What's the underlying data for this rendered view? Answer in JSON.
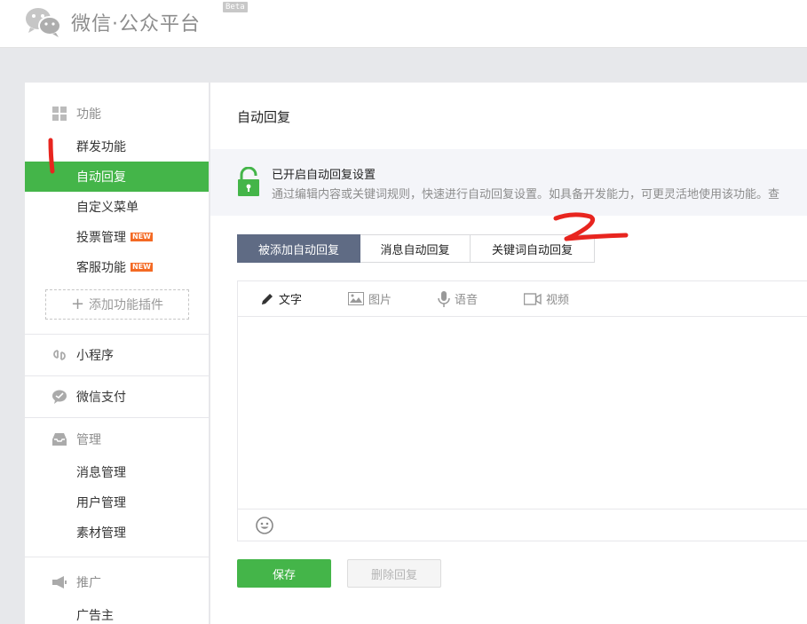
{
  "header": {
    "logo_icon": "wechat-icon",
    "title": "微信·公众平台",
    "beta": "Beta"
  },
  "sidebar": {
    "groups": [
      {
        "label": "功能",
        "icon": "grid-icon",
        "items": [
          {
            "label": "群发功能"
          },
          {
            "label": "自动回复",
            "active": true
          },
          {
            "label": "自定义菜单"
          },
          {
            "label": "投票管理",
            "badge": "NEW"
          },
          {
            "label": "客服功能",
            "badge": "NEW"
          }
        ],
        "add_plugin": "添加功能插件"
      },
      {
        "label": "小程序",
        "icon": "link-icon"
      },
      {
        "label": "微信支付",
        "icon": "pay-icon"
      },
      {
        "label": "管理",
        "icon": "inbox-icon",
        "items": [
          {
            "label": "消息管理"
          },
          {
            "label": "用户管理"
          },
          {
            "label": "素材管理"
          }
        ]
      },
      {
        "label": "推广",
        "icon": "megaphone-icon",
        "items": [
          {
            "label": "广告主"
          }
        ]
      }
    ]
  },
  "main": {
    "title": "自动回复",
    "notice": {
      "icon": "unlock-icon",
      "title": "已开启自动回复设置",
      "desc": "通过编辑内容或关键词规则，快速进行自动回复设置。如具备开发能力，可更灵活地使用该功能。查"
    },
    "tabs": [
      {
        "label": "被添加自动回复",
        "active": true
      },
      {
        "label": "消息自动回复"
      },
      {
        "label": "关键词自动回复"
      }
    ],
    "editor_tools": [
      {
        "label": "文字",
        "icon": "pencil-icon",
        "active": true
      },
      {
        "label": "图片",
        "icon": "image-icon"
      },
      {
        "label": "语音",
        "icon": "microphone-icon"
      },
      {
        "label": "视频",
        "icon": "video-icon"
      }
    ],
    "emoji_icon": "emoji-icon",
    "save_label": "保存",
    "delete_label": "删除回复"
  },
  "annotations": [
    "1",
    "2"
  ],
  "colors": {
    "accent": "#44b549",
    "tab_active": "#5f6b84",
    "badge": "#f46a24",
    "annotation": "#e8251f"
  }
}
